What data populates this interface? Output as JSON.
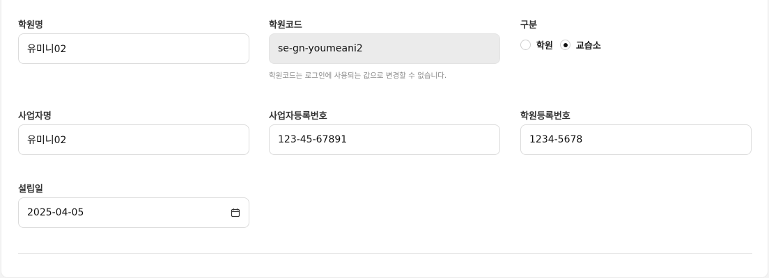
{
  "academy_name": {
    "label": "학원명",
    "value": "유미니02"
  },
  "academy_code": {
    "label": "학원코드",
    "value": "se-gn-youmeani2",
    "hint": "학원코드는 로그인에 사용되는 값으로 변경할 수 없습니다."
  },
  "category": {
    "label": "구분",
    "options": [
      {
        "label": "학원",
        "checked": false
      },
      {
        "label": "교습소",
        "checked": true
      }
    ]
  },
  "business_name": {
    "label": "사업자명",
    "value": "유미니02"
  },
  "business_reg_no": {
    "label": "사업자등록번호",
    "value": "123-45-67891"
  },
  "academy_reg_no": {
    "label": "학원등록번호",
    "value": "1234-5678"
  },
  "founding_date": {
    "label": "설립일",
    "value": "2025-04-05",
    "icon": "calendar-icon"
  }
}
